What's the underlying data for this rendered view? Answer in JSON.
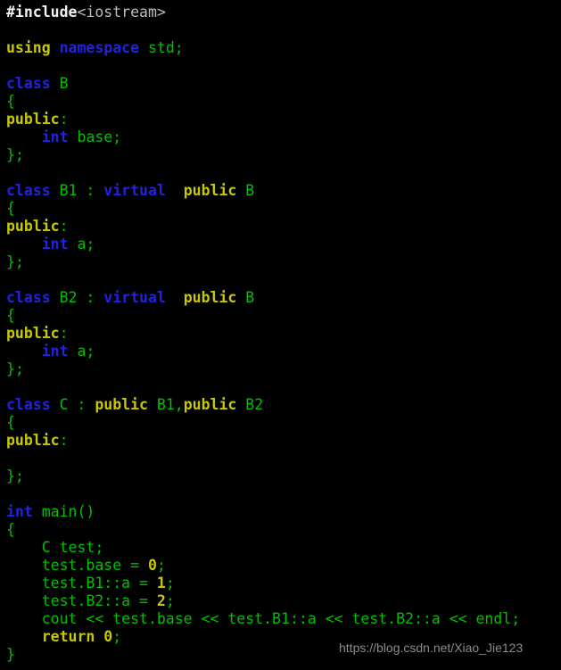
{
  "editor": {
    "background_color": "#000000",
    "language": "C++",
    "palette": {
      "keyword_blue": "#2222e0",
      "keyword_gold": "#c8c800",
      "identifier_green": "#00c000",
      "preprocessor_white": "#f2f2f2",
      "header_gray": "#bdbdbd",
      "number_gold": "#c8c800",
      "watermark_gray": "#8a8a8a"
    },
    "lines": [
      {
        "n": 1,
        "tokens": [
          {
            "text": "#include",
            "cls": "t-inc"
          },
          {
            "text": "<iostream>",
            "cls": "t-header"
          }
        ]
      },
      {
        "n": 2,
        "tokens": []
      },
      {
        "n": 3,
        "tokens": [
          {
            "text": "using",
            "cls": "t-kw2"
          },
          {
            "text": " ",
            "cls": "t-plain"
          },
          {
            "text": "namespace",
            "cls": "t-kw"
          },
          {
            "text": " ",
            "cls": "t-plain"
          },
          {
            "text": "std;",
            "cls": "t-id"
          }
        ]
      },
      {
        "n": 4,
        "tokens": []
      },
      {
        "n": 5,
        "tokens": [
          {
            "text": "class",
            "cls": "t-kw"
          },
          {
            "text": " ",
            "cls": "t-plain"
          },
          {
            "text": "B",
            "cls": "t-id"
          }
        ]
      },
      {
        "n": 6,
        "tokens": [
          {
            "text": "{",
            "cls": "t-id"
          }
        ]
      },
      {
        "n": 7,
        "tokens": [
          {
            "text": "public",
            "cls": "t-kw2"
          },
          {
            "text": ":",
            "cls": "t-id"
          }
        ]
      },
      {
        "n": 8,
        "tokens": [
          {
            "text": "    ",
            "cls": "t-plain"
          },
          {
            "text": "int",
            "cls": "t-kw"
          },
          {
            "text": " ",
            "cls": "t-plain"
          },
          {
            "text": "base;",
            "cls": "t-id"
          }
        ]
      },
      {
        "n": 9,
        "tokens": [
          {
            "text": "};",
            "cls": "t-id"
          }
        ]
      },
      {
        "n": 10,
        "tokens": []
      },
      {
        "n": 11,
        "tokens": [
          {
            "text": "class",
            "cls": "t-kw"
          },
          {
            "text": " ",
            "cls": "t-plain"
          },
          {
            "text": "B1 : ",
            "cls": "t-id"
          },
          {
            "text": "virtual",
            "cls": "t-kw"
          },
          {
            "text": "  ",
            "cls": "t-plain"
          },
          {
            "text": "public",
            "cls": "t-kw2"
          },
          {
            "text": " ",
            "cls": "t-plain"
          },
          {
            "text": "B",
            "cls": "t-id"
          }
        ]
      },
      {
        "n": 12,
        "tokens": [
          {
            "text": "{",
            "cls": "t-id"
          }
        ]
      },
      {
        "n": 13,
        "tokens": [
          {
            "text": "public",
            "cls": "t-kw2"
          },
          {
            "text": ":",
            "cls": "t-id"
          }
        ]
      },
      {
        "n": 14,
        "tokens": [
          {
            "text": "    ",
            "cls": "t-plain"
          },
          {
            "text": "int",
            "cls": "t-kw"
          },
          {
            "text": " ",
            "cls": "t-plain"
          },
          {
            "text": "a;",
            "cls": "t-id"
          }
        ]
      },
      {
        "n": 15,
        "tokens": [
          {
            "text": "};",
            "cls": "t-id"
          }
        ]
      },
      {
        "n": 16,
        "tokens": []
      },
      {
        "n": 17,
        "tokens": [
          {
            "text": "class",
            "cls": "t-kw"
          },
          {
            "text": " ",
            "cls": "t-plain"
          },
          {
            "text": "B2 : ",
            "cls": "t-id"
          },
          {
            "text": "virtual",
            "cls": "t-kw"
          },
          {
            "text": "  ",
            "cls": "t-plain"
          },
          {
            "text": "public",
            "cls": "t-kw2"
          },
          {
            "text": " ",
            "cls": "t-plain"
          },
          {
            "text": "B",
            "cls": "t-id"
          }
        ]
      },
      {
        "n": 18,
        "tokens": [
          {
            "text": "{",
            "cls": "t-id"
          }
        ]
      },
      {
        "n": 19,
        "tokens": [
          {
            "text": "public",
            "cls": "t-kw2"
          },
          {
            "text": ":",
            "cls": "t-id"
          }
        ]
      },
      {
        "n": 20,
        "tokens": [
          {
            "text": "    ",
            "cls": "t-plain"
          },
          {
            "text": "int",
            "cls": "t-kw"
          },
          {
            "text": " ",
            "cls": "t-plain"
          },
          {
            "text": "a;",
            "cls": "t-id"
          }
        ]
      },
      {
        "n": 21,
        "tokens": [
          {
            "text": "};",
            "cls": "t-id"
          }
        ]
      },
      {
        "n": 22,
        "tokens": []
      },
      {
        "n": 23,
        "tokens": [
          {
            "text": "class",
            "cls": "t-kw"
          },
          {
            "text": " ",
            "cls": "t-plain"
          },
          {
            "text": "C : ",
            "cls": "t-id"
          },
          {
            "text": "public",
            "cls": "t-kw2"
          },
          {
            "text": " ",
            "cls": "t-plain"
          },
          {
            "text": "B1,",
            "cls": "t-id"
          },
          {
            "text": "public",
            "cls": "t-kw2"
          },
          {
            "text": " ",
            "cls": "t-plain"
          },
          {
            "text": "B2",
            "cls": "t-id"
          }
        ]
      },
      {
        "n": 24,
        "tokens": [
          {
            "text": "{",
            "cls": "t-id"
          }
        ]
      },
      {
        "n": 25,
        "tokens": [
          {
            "text": "public",
            "cls": "t-kw2"
          },
          {
            "text": ":",
            "cls": "t-id"
          }
        ]
      },
      {
        "n": 26,
        "tokens": []
      },
      {
        "n": 27,
        "tokens": [
          {
            "text": "};",
            "cls": "t-id"
          }
        ]
      },
      {
        "n": 28,
        "tokens": []
      },
      {
        "n": 29,
        "tokens": [
          {
            "text": "int",
            "cls": "t-kw"
          },
          {
            "text": " ",
            "cls": "t-plain"
          },
          {
            "text": "main()",
            "cls": "t-id"
          }
        ]
      },
      {
        "n": 30,
        "tokens": [
          {
            "text": "{",
            "cls": "t-id"
          }
        ]
      },
      {
        "n": 31,
        "tokens": [
          {
            "text": "    C test;",
            "cls": "t-id"
          }
        ]
      },
      {
        "n": 32,
        "tokens": [
          {
            "text": "    test.base = ",
            "cls": "t-id"
          },
          {
            "text": "0",
            "cls": "t-num"
          },
          {
            "text": ";",
            "cls": "t-id"
          }
        ]
      },
      {
        "n": 33,
        "tokens": [
          {
            "text": "    test.B1::a = ",
            "cls": "t-id"
          },
          {
            "text": "1",
            "cls": "t-num"
          },
          {
            "text": ";",
            "cls": "t-id"
          }
        ]
      },
      {
        "n": 34,
        "tokens": [
          {
            "text": "    test.B2::a = ",
            "cls": "t-id"
          },
          {
            "text": "2",
            "cls": "t-num"
          },
          {
            "text": ";",
            "cls": "t-id"
          }
        ]
      },
      {
        "n": 35,
        "tokens": [
          {
            "text": "    cout << test.base << test.B1::a << test.B2::a << endl;",
            "cls": "t-id"
          }
        ]
      },
      {
        "n": 36,
        "tokens": [
          {
            "text": "    ",
            "cls": "t-plain"
          },
          {
            "text": "return",
            "cls": "t-kw2"
          },
          {
            "text": " ",
            "cls": "t-plain"
          },
          {
            "text": "0",
            "cls": "t-num"
          },
          {
            "text": ";",
            "cls": "t-id"
          }
        ]
      },
      {
        "n": 37,
        "tokens": [
          {
            "text": "}",
            "cls": "t-id"
          }
        ]
      }
    ]
  },
  "watermark": {
    "text": "https://blog.csdn.net/Xiao_Jie123"
  }
}
